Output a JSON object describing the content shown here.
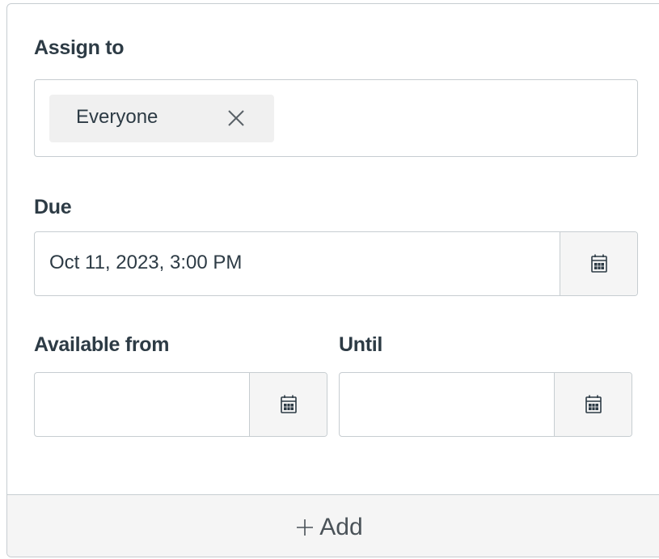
{
  "assign": {
    "label": "Assign to",
    "tags": [
      {
        "label": "Everyone"
      }
    ]
  },
  "due": {
    "label": "Due",
    "value": "Oct 11, 2023, 3:00 PM"
  },
  "available_from": {
    "label": "Available from",
    "value": ""
  },
  "until": {
    "label": "Until",
    "value": ""
  },
  "add": {
    "label": "Add",
    "icon": "plus-icon"
  },
  "icons": {
    "calendar": "calendar-icon",
    "remove": "close-icon"
  }
}
